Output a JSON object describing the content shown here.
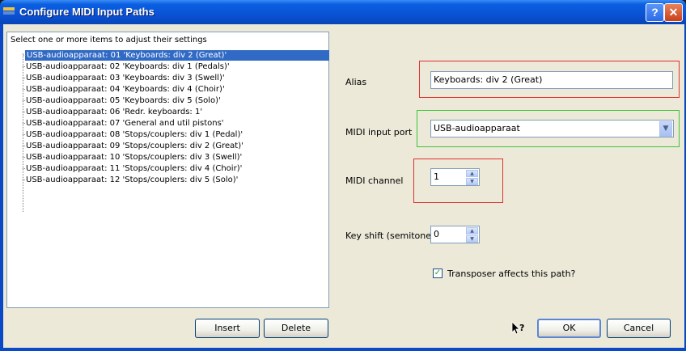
{
  "window": {
    "title": "Configure MIDI Input Paths",
    "help_label": "?",
    "close_label": "✕"
  },
  "list": {
    "header": "Select one or more items to adjust their settings",
    "items": [
      "USB-audioapparaat: 01 'Keyboards: div 2 (Great)'",
      "USB-audioapparaat: 02 'Keyboards: div 1 (Pedals)'",
      "USB-audioapparaat: 03 'Keyboards: div 3 (Swell)'",
      "USB-audioapparaat: 04 'Keyboards: div 4 (Choir)'",
      "USB-audioapparaat: 05 'Keyboards: div 5 (Solo)'",
      "USB-audioapparaat: 06 'Redr. keyboards: 1'",
      "USB-audioapparaat: 07 'General and util pistons'",
      "USB-audioapparaat: 08 'Stops/couplers: div 1 (Pedal)'",
      "USB-audioapparaat: 09 'Stops/couplers: div 2 (Great)'",
      "USB-audioapparaat: 10 'Stops/couplers: div 3 (Swell)'",
      "USB-audioapparaat: 11 'Stops/couplers: div 4 (Choir)'",
      "USB-audioapparaat: 12 'Stops/couplers: div 5 (Solo)'"
    ],
    "selected_index": 0
  },
  "form": {
    "alias_label": "Alias",
    "alias_value": "Keyboards: div 2 (Great)",
    "port_label": "MIDI input port",
    "port_value": "USB-audioapparaat",
    "channel_label": "MIDI channel",
    "channel_value": "1",
    "keyshift_label": "Key shift (semitones)",
    "keyshift_value": "0",
    "transposer_label": "Transposer affects this path?",
    "transposer_checked": true
  },
  "buttons": {
    "insert": "Insert",
    "delete": "Delete",
    "ok": "OK",
    "cancel": "Cancel"
  },
  "colors": {
    "selection": "#316ac5",
    "highlight_red": "#e03030",
    "highlight_green": "#3cc43c"
  }
}
